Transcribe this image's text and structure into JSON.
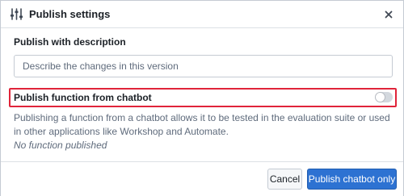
{
  "dialog": {
    "title": "Publish settings",
    "header_icon": "settings-sliders-icon",
    "close_icon": "close-icon"
  },
  "description": {
    "label": "Publish with description",
    "placeholder": "Describe the changes in this version",
    "value": ""
  },
  "function_toggle": {
    "label": "Publish function from chatbot",
    "enabled": false,
    "help_text": "Publishing a function from a chatbot allows it to be tested in the evaluation suite or used in other applications like Workshop and Automate.",
    "status_text": "No function published",
    "highlight_color": "#e0243a"
  },
  "footer": {
    "cancel_label": "Cancel",
    "primary_label": "Publish chatbot only",
    "primary_color": "#2d72d2"
  }
}
